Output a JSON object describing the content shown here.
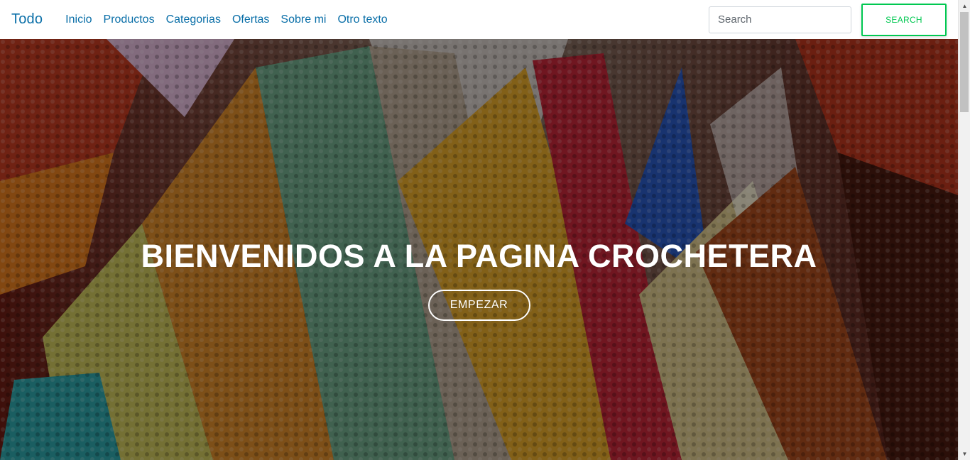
{
  "navbar": {
    "brand": "Todo",
    "links": [
      "Inicio",
      "Productos",
      "Categorias",
      "Ofertas",
      "Sobre mi",
      "Otro texto"
    ],
    "search_placeholder": "Search",
    "search_value": "",
    "search_button": "SEARCH"
  },
  "hero": {
    "title": "BIENVENIDOS A LA PAGINA CROCHETERA",
    "button": "EMPEZAR"
  },
  "colors": {
    "link": "#0a6fa8",
    "search_button": "#00c851",
    "hero_text": "#ffffff"
  },
  "icons": {
    "scroll_up": "scroll-up-arrow-icon",
    "scroll_down": "scroll-down-arrow-icon"
  }
}
